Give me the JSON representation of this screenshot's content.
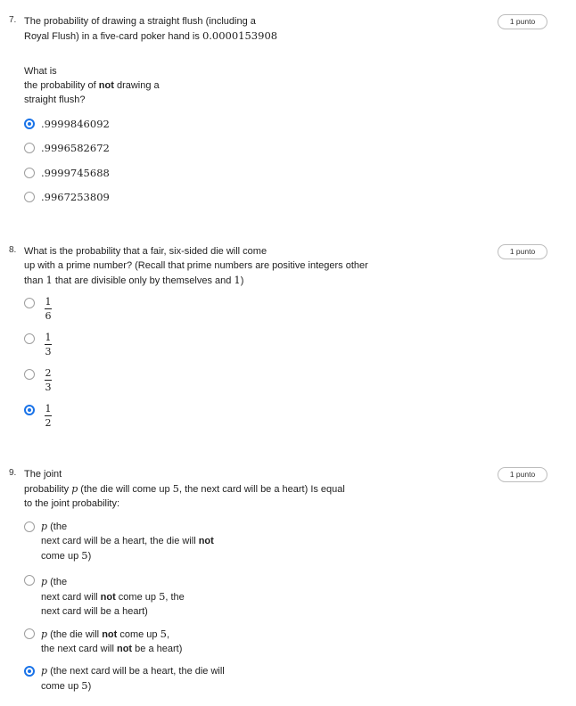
{
  "questions": [
    {
      "number": "7.",
      "points": "1 punto",
      "text_line1": "The probability of drawing a straight flush (including a",
      "text_line2_pre": "Royal Flush) in a five-card poker hand is ",
      "text_line2_math": "0.0000153908",
      "sub_line1": "What is",
      "sub_line2_pre": "the probability of ",
      "sub_line2_bold": "not",
      "sub_line2_post": " drawing a",
      "sub_line3": "straight flush?",
      "options": [
        ".9999846092",
        ".9996582672",
        ".9999745688",
        ".9967253809"
      ],
      "selected_index": 0
    },
    {
      "number": "8.",
      "points": "1 punto",
      "text_line1": "What is the probability that a fair, six-sided die will come",
      "text_line2": "up with a prime number? (Recall that prime numbers are positive integers other",
      "text_line3_pre": "than ",
      "text_line3_math": "1",
      "text_line3_post": " that are divisible only by themselves and ",
      "text_line3_math2": "1",
      "text_line3_end": ")",
      "options": [
        {
          "num": "1",
          "den": "6"
        },
        {
          "num": "1",
          "den": "3"
        },
        {
          "num": "2",
          "den": "3"
        },
        {
          "num": "1",
          "den": "2"
        }
      ],
      "selected_index": 3
    },
    {
      "number": "9.",
      "points": "1 punto",
      "text_line1": "The joint",
      "text_line2_pre": "probability ",
      "text_line2_p": "p",
      "text_line2_mid": " (the die will come up ",
      "text_line2_math": "5",
      "text_line2_post": ", the next card will be a heart) Is equal",
      "text_line3": "to the joint probability:",
      "options": [
        {
          "l1_p": "p",
          "l1": " (the",
          "l2_pre": "next card will be a heart, the die will ",
          "l2_bold": "not",
          "l3_pre": "come up ",
          "l3_math": "5",
          "l3_post": ")"
        },
        {
          "l1_p": "p",
          "l1": " (the",
          "l2_pre": "next card will ",
          "l2_bold": "not",
          "l2_mid": " come up ",
          "l2_math": "5",
          "l2_post": ", the",
          "l3": "next card will be a heart)"
        },
        {
          "l1_p": "p",
          "l1_pre": " (the die will ",
          "l1_bold": "not",
          "l1_mid": " come up ",
          "l1_math": "5",
          "l1_post": ",",
          "l2_pre": "the next card will ",
          "l2_bold": "not",
          "l2_post": " be a heart)"
        },
        {
          "l1_p": "p",
          "l1": " (the next card will be a heart, the die will",
          "l2_pre": "come up ",
          "l2_math": "5",
          "l2_post": ")"
        }
      ],
      "selected_index": 3
    }
  ]
}
